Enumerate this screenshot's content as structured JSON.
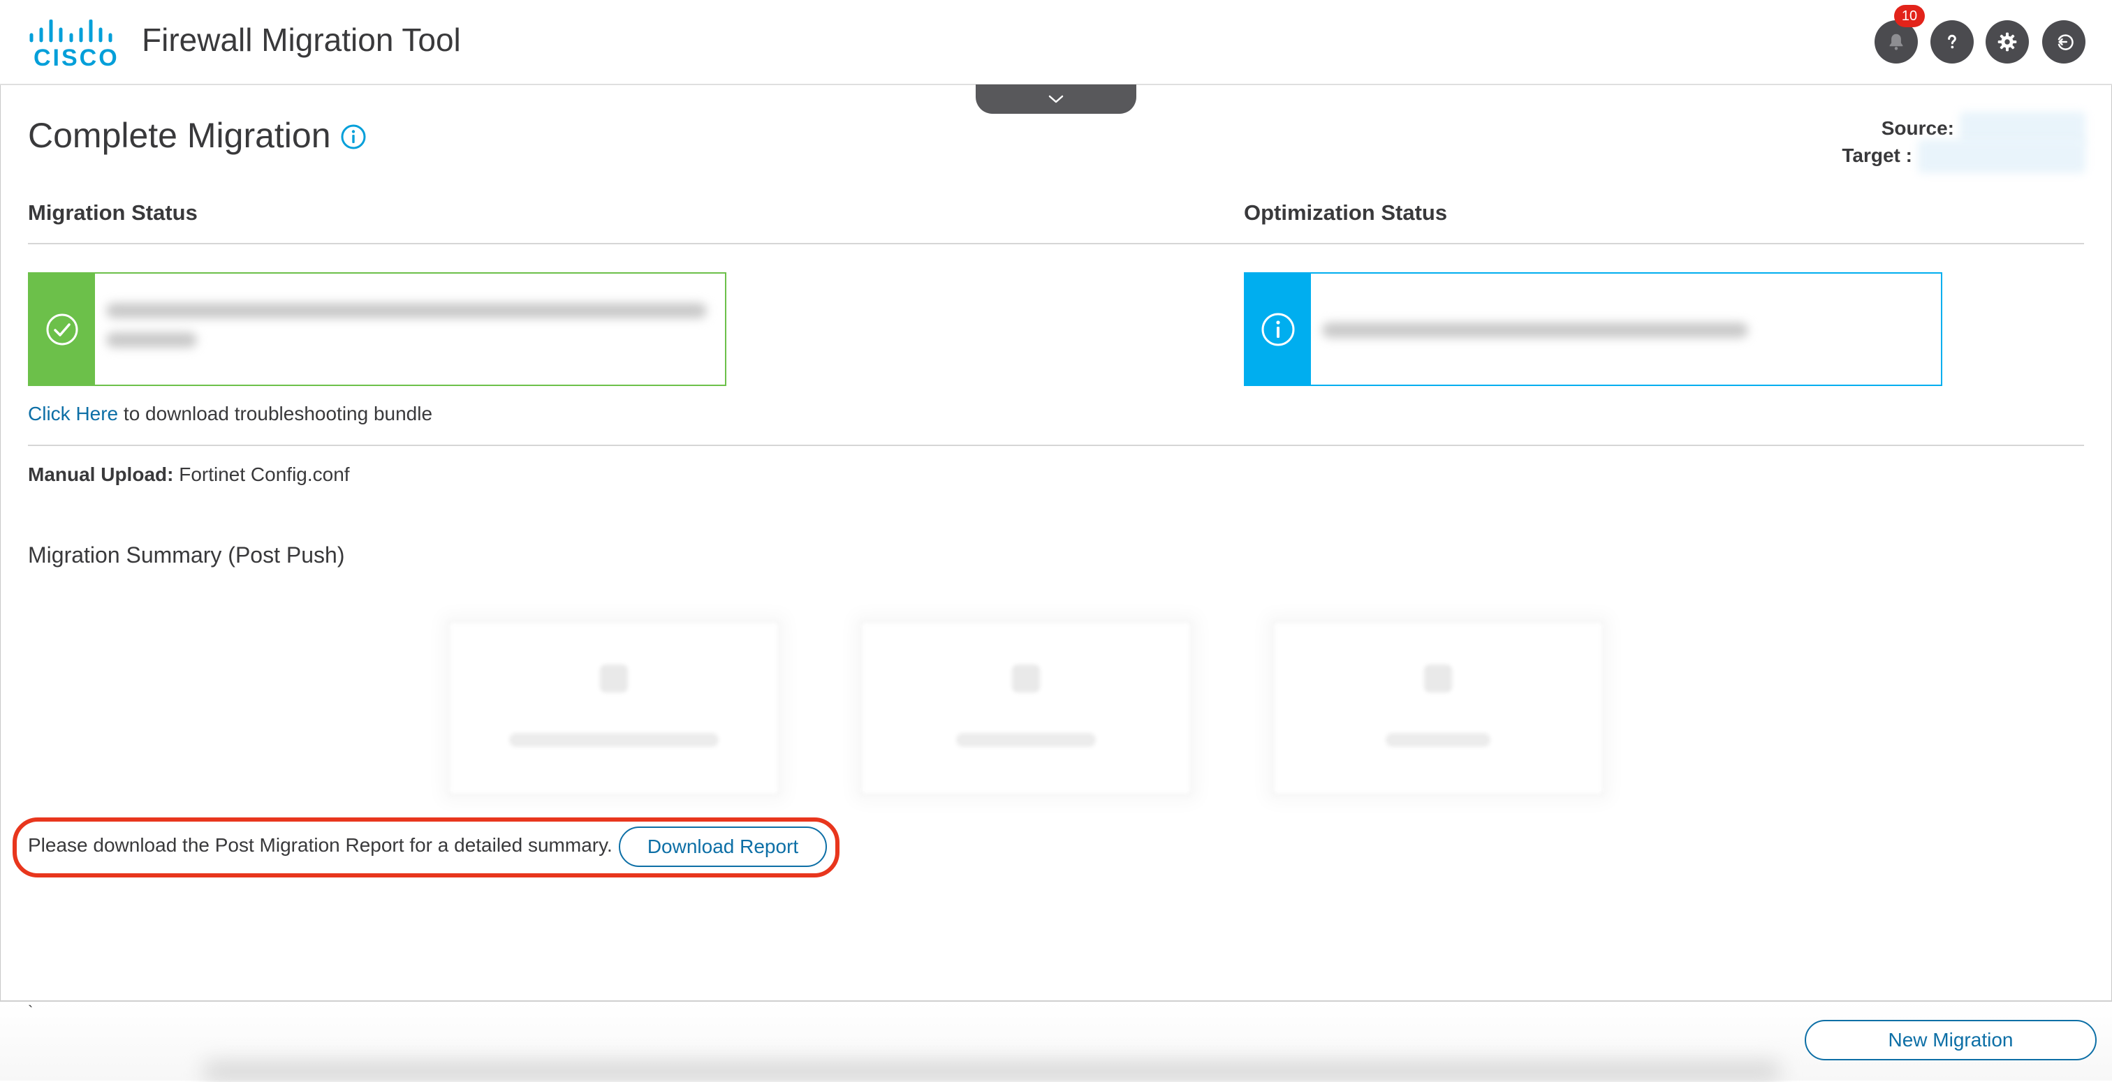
{
  "app": {
    "title": "Firewall Migration Tool",
    "brand": "CISCO",
    "notification_count": "10"
  },
  "icons": {
    "bell": "bell-icon",
    "help": "help-icon",
    "settings": "gear-icon",
    "logout": "logout-icon",
    "chevron": "chevron-down-icon",
    "info": "info-icon",
    "success": "check-circle-icon"
  },
  "page": {
    "title": "Complete Migration",
    "source_label": "Source:",
    "target_label": "Target :"
  },
  "migration_status": {
    "title": "Migration Status"
  },
  "optimization_status": {
    "title": "Optimization Status"
  },
  "troubleshoot": {
    "link_text": "Click Here",
    "rest_text": " to download troubleshooting bundle"
  },
  "upload": {
    "label": "Manual Upload:",
    "value": " Fortinet Config.conf"
  },
  "summary": {
    "title": "Migration Summary (Post Push)"
  },
  "report": {
    "text": "Please download the Post Migration Report for a detailed summary.",
    "button_label": "Download Report"
  },
  "footer": {
    "marker": "`",
    "new_migration_label": "New Migration"
  },
  "colors": {
    "brand_blue": "#049fd9",
    "link_blue": "#0d6fa6",
    "success_green": "#6cc04a",
    "info_blue": "#00aeef",
    "highlight_red": "#e8361d",
    "badge_red": "#e2231a"
  }
}
